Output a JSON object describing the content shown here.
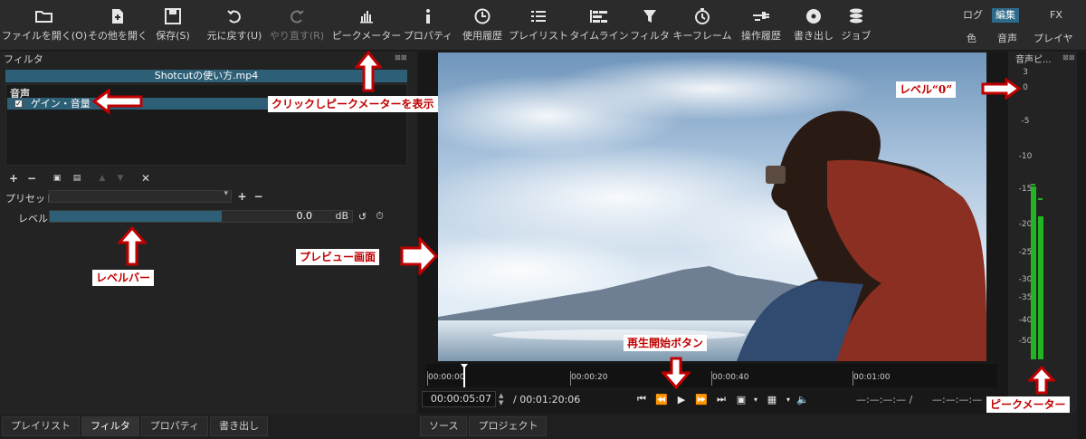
{
  "toolbar": {
    "buttons": [
      {
        "label": "ファイルを開く(O)",
        "icon": "folder-open-icon"
      },
      {
        "label": "その他を開く",
        "icon": "file-add-icon"
      },
      {
        "label": "保存(S)",
        "icon": "save-icon"
      },
      {
        "label": "元に戻す(U)",
        "icon": "undo-icon"
      },
      {
        "label": "やり直す(R)",
        "icon": "redo-icon"
      },
      {
        "label": "ピークメーター",
        "icon": "peak-meter-icon"
      },
      {
        "label": "プロパティ",
        "icon": "info-icon"
      },
      {
        "label": "使用履歴",
        "icon": "clock-icon"
      },
      {
        "label": "プレイリスト",
        "icon": "list-icon"
      },
      {
        "label": "タイムライン",
        "icon": "timeline-icon"
      },
      {
        "label": "フィルタ",
        "icon": "filter-icon"
      },
      {
        "label": "キーフレーム",
        "icon": "stopwatch-icon"
      },
      {
        "label": "操作履歴",
        "icon": "history-icon"
      },
      {
        "label": "書き出し",
        "icon": "export-disc-icon"
      },
      {
        "label": "ジョブ",
        "icon": "jobs-icon"
      }
    ],
    "layout_tabs": {
      "log": "ログ",
      "edit": "編集",
      "fx": "FX",
      "color": "色",
      "audio": "音声",
      "player": "プレイヤー"
    }
  },
  "filter_panel": {
    "title": "フィルタ",
    "clip_name": "Shotcutの使い方.mp4",
    "category": "音声",
    "filter_item": "ゲイン・音量",
    "filter_checked": "✓",
    "preset_label": "プリセット",
    "level_label": "レベル",
    "level_value": "0.0",
    "level_unit": "dB",
    "level_fill_fraction": 0.57
  },
  "bottom_tabs_left": [
    "プレイリスト",
    "フィルタ",
    "プロパティ",
    "書き出し"
  ],
  "bottom_tabs_right": [
    "ソース",
    "プロジェクト"
  ],
  "ruler": {
    "ticks": [
      "00:00:00",
      "00:00:20",
      "00:00:40",
      "00:01:00"
    ]
  },
  "transport": {
    "current": "00:00:05:07",
    "total": "/ 00:01:20:06",
    "in_point": "—:—:—:— /",
    "out_point": "—:—:—:—"
  },
  "meter": {
    "title": "音声ピ...",
    "scale": [
      "3",
      "0",
      "-5",
      "-10",
      "-15",
      "-20",
      "-25",
      "-30",
      "-35",
      "-40",
      "-50"
    ],
    "left_level_db": -20,
    "right_level_db": -26
  },
  "annotations": {
    "peak_meter_button": "クリックしピークメーターを表示",
    "level_zero": "レベル“0”",
    "preview": "プレビュー画面",
    "level_bar": "レベルバー",
    "play_button": "再生開始ボタン",
    "peak_meter": "ピークメーター"
  },
  "colors": {
    "accent": "#2d5f77",
    "meter_green": "#22b422",
    "callout_red": "#c00000"
  }
}
